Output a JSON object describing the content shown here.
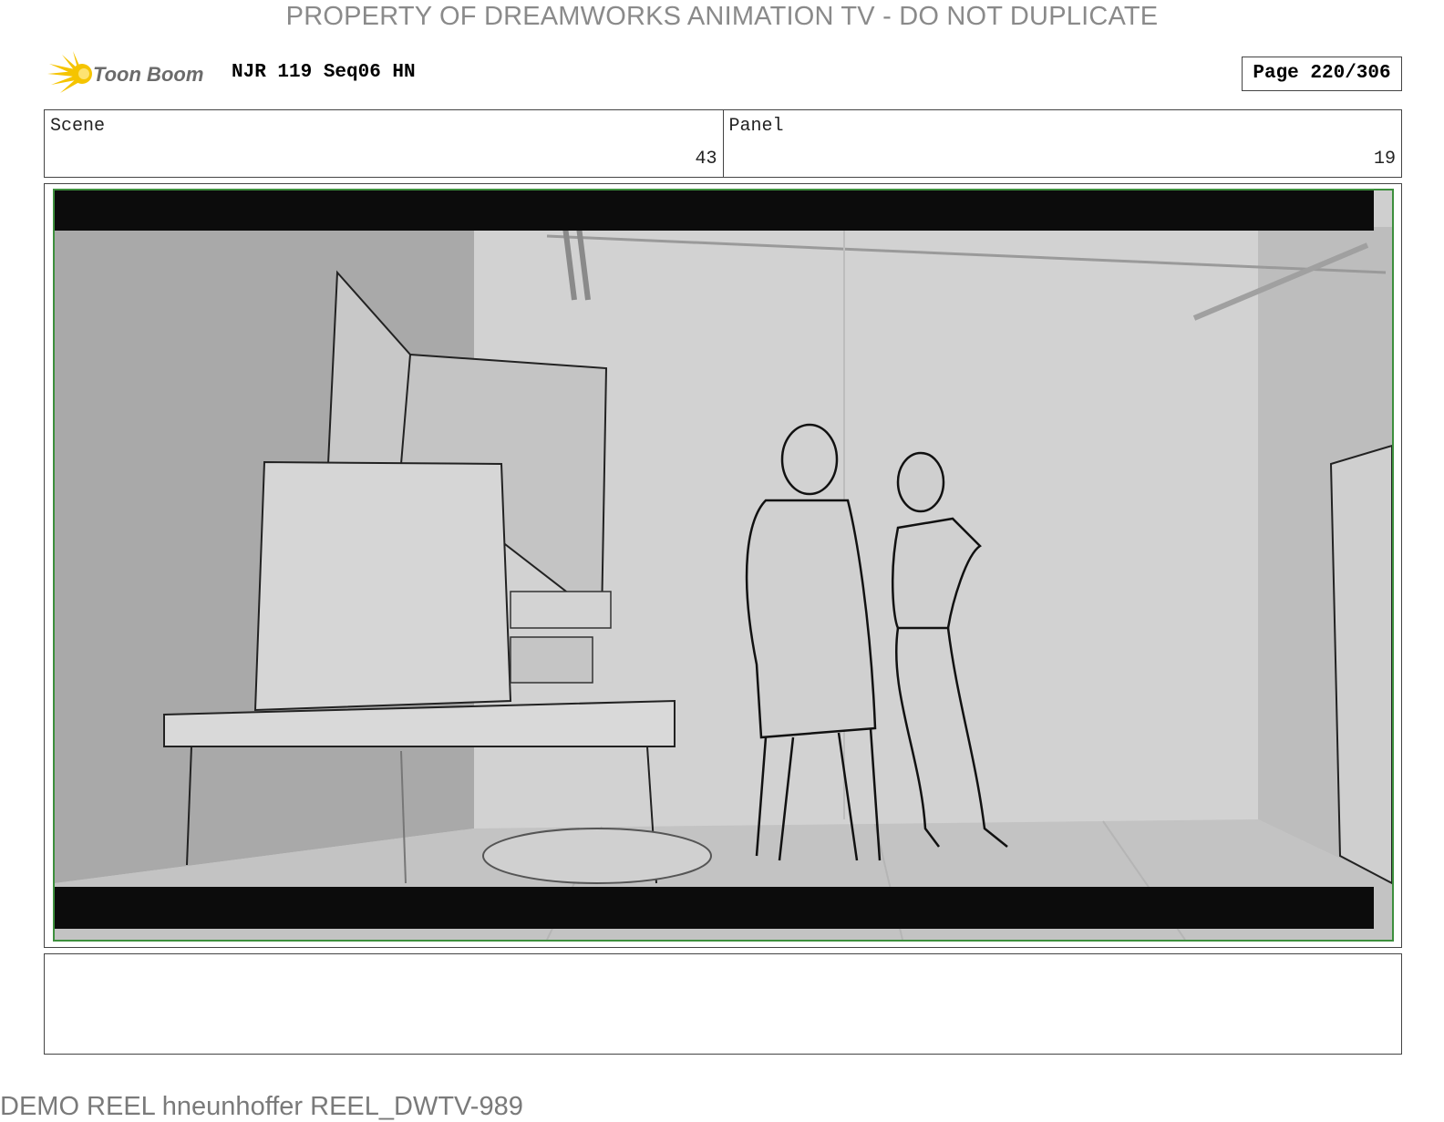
{
  "header": {
    "watermark": "PROPERTY OF DREAMWORKS ANIMATION TV - DO NOT DUPLICATE",
    "logo_text": "Toon Boom",
    "logo_icon": "toon-boom-sun-icon",
    "doc_title": "NJR 119 Seq06 HN",
    "page_label": "Page 220/306"
  },
  "info": {
    "scene_label": "Scene",
    "scene_value": "43",
    "panel_label": "Panel",
    "panel_value": "19"
  },
  "panel": {
    "image_desc": "storyboard-sketch",
    "frame_color": "#3d8f3d"
  },
  "notes": {
    "text": ""
  },
  "footer": {
    "text": "DEMO REEL hneunhoffer REEL_DWTV-989"
  }
}
